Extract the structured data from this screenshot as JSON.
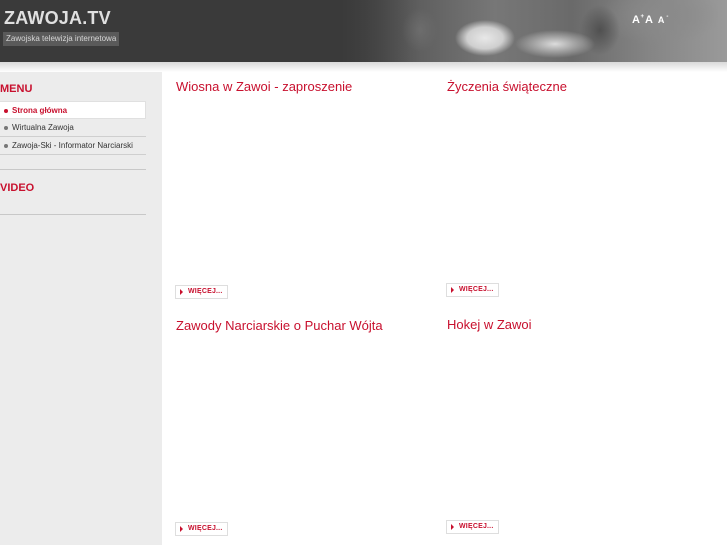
{
  "header": {
    "site_title": "ZAWOJA.TV",
    "tagline": "Zawojska telewizja internetowa",
    "font_tools": {
      "large": "A",
      "large_sup": "+",
      "normal": "A",
      "small": "A",
      "small_sup": "-"
    }
  },
  "sidebar": {
    "menu_heading": "MENU",
    "menu_items": [
      {
        "label": "Strona główna",
        "active": true
      },
      {
        "label": "Wirtualna Zawoja",
        "active": false
      },
      {
        "label": "Zawoja-Ski - Informator Narciarski",
        "active": false
      }
    ],
    "video_heading": "VIDEO"
  },
  "articles": [
    {
      "title": "Wiosna w Zawoi - zaproszenie",
      "more_label": "WIĘCEJ..."
    },
    {
      "title": "Życzenia świąteczne",
      "more_label": "WIĘCEJ..."
    },
    {
      "title": "Zawody Narciarskie o Puchar Wójta",
      "more_label": "WIĘCEJ..."
    },
    {
      "title": "Hokej w Zawoi",
      "more_label": "WIĘCEJ..."
    }
  ],
  "colors": {
    "accent": "#c8102e",
    "header_bg": "#3a3a3a",
    "sidebar_bg": "#ececec"
  }
}
